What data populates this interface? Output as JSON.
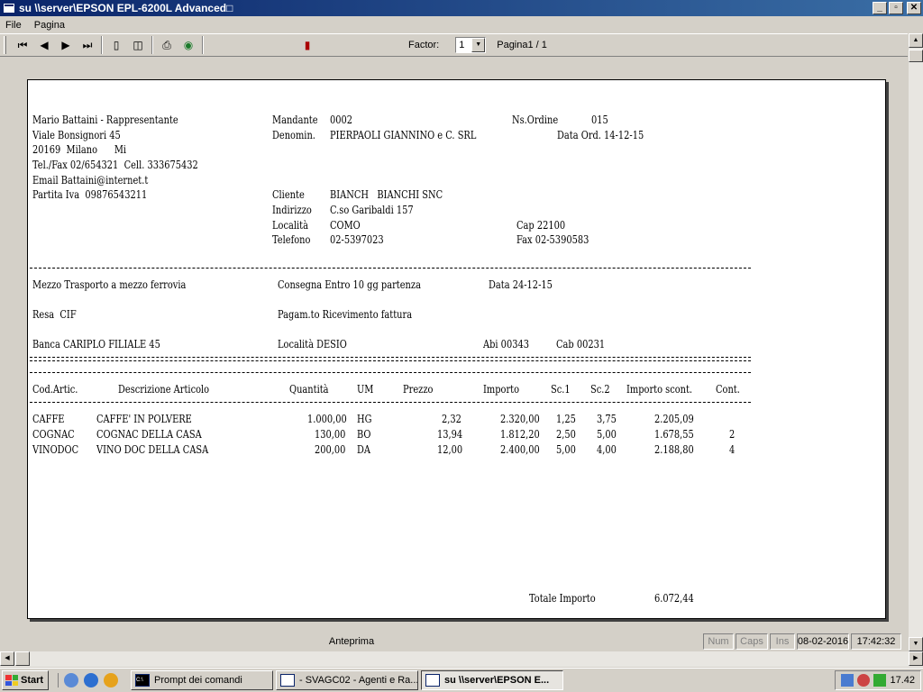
{
  "window": {
    "title": "su \\\\server\\EPSON EPL-6200L Advanced□"
  },
  "menu": {
    "items": [
      "File",
      "Pagina"
    ]
  },
  "toolbar": {
    "factor_label": "Factor:",
    "factor_value": "1",
    "page_label": "Pagina1 / 1"
  },
  "document": {
    "agent": [
      "Mario Battaini - Rappresentante",
      "Viale Bonsignori 45",
      "20169  Milano      Mi",
      "Tel./Fax 02/654321  Cell. 333675432",
      "Email Battaini@internet.t",
      "Partita Iva  09876543211"
    ],
    "mandante_label": "Mandante",
    "mandante_value": "0002",
    "ns_ordine_label": "Ns.Ordine",
    "ns_ordine_value": "015",
    "denom_label": "Denomin.",
    "denom_value": "PIERPAOLI GIANNINO e C. SRL",
    "data_ord": "Data Ord. 14-12-15",
    "cliente_label": "Cliente",
    "cliente_value": "BIANCH   BIANCHI SNC",
    "indirizzo_label": "Indirizzo",
    "indirizzo_value": "C.so Garibaldi 157",
    "localita_label": "Località",
    "localita_value": "COMO",
    "cap": "Cap 22100",
    "telefono_label": "Telefono",
    "telefono_value": "02-5397023",
    "fax": "Fax 02-5390583",
    "mezzo": "Mezzo Trasporto a mezzo ferrovia",
    "consegna": "Consegna Entro 10 gg partenza",
    "data_consegna": "Data 24-12-15",
    "resa": "Resa  CIF",
    "pagamento": "Pagam.to Ricevimento fattura",
    "banca": "Banca CARIPLO FILIALE 45",
    "banca_localita": "Località DESIO",
    "abi": "Abi 00343",
    "cab": "Cab 00231",
    "table_headers": [
      "Cod.Artic.",
      "Descrizione Articolo",
      "Quantità",
      "UM",
      "Prezzo",
      "Importo",
      "Sc.1",
      "Sc.2",
      "Importo scont.",
      "Cont."
    ],
    "rows": [
      {
        "cod": "CAFFE",
        "desc": "CAFFE' IN POLVERE",
        "qty": "1.000,00",
        "um": "HG",
        "price": "2,32",
        "amount": "2.320,00",
        "sc1": "1,25",
        "sc2": "3,75",
        "net": "2.205,09",
        "cont": ""
      },
      {
        "cod": "COGNAC",
        "desc": "COGNAC DELLA CASA",
        "qty": "130,00",
        "um": "BO",
        "price": "13,94",
        "amount": "1.812,20",
        "sc1": "2,50",
        "sc2": "5,00",
        "net": "1.678,55",
        "cont": "2"
      },
      {
        "cod": "VINODOC",
        "desc": "VINO DOC DELLA CASA",
        "qty": "200,00",
        "um": "DA",
        "price": "12,00",
        "amount": "2.400,00",
        "sc1": "5,00",
        "sc2": "4,00",
        "net": "2.188,80",
        "cont": "4"
      }
    ],
    "total_label": "Totale Importo",
    "total_value": "6.072,44"
  },
  "status": {
    "main": "Anteprima",
    "num": "Num",
    "caps": "Caps",
    "ins": "Ins",
    "date": "08-02-2016",
    "time": "17:42:32"
  },
  "taskbar": {
    "start": "Start",
    "tasks": [
      "Prompt dei comandi",
      "- SVAGC02 - Agenti e Ra...",
      "su \\\\server\\EPSON E..."
    ],
    "clock": "17.42"
  }
}
